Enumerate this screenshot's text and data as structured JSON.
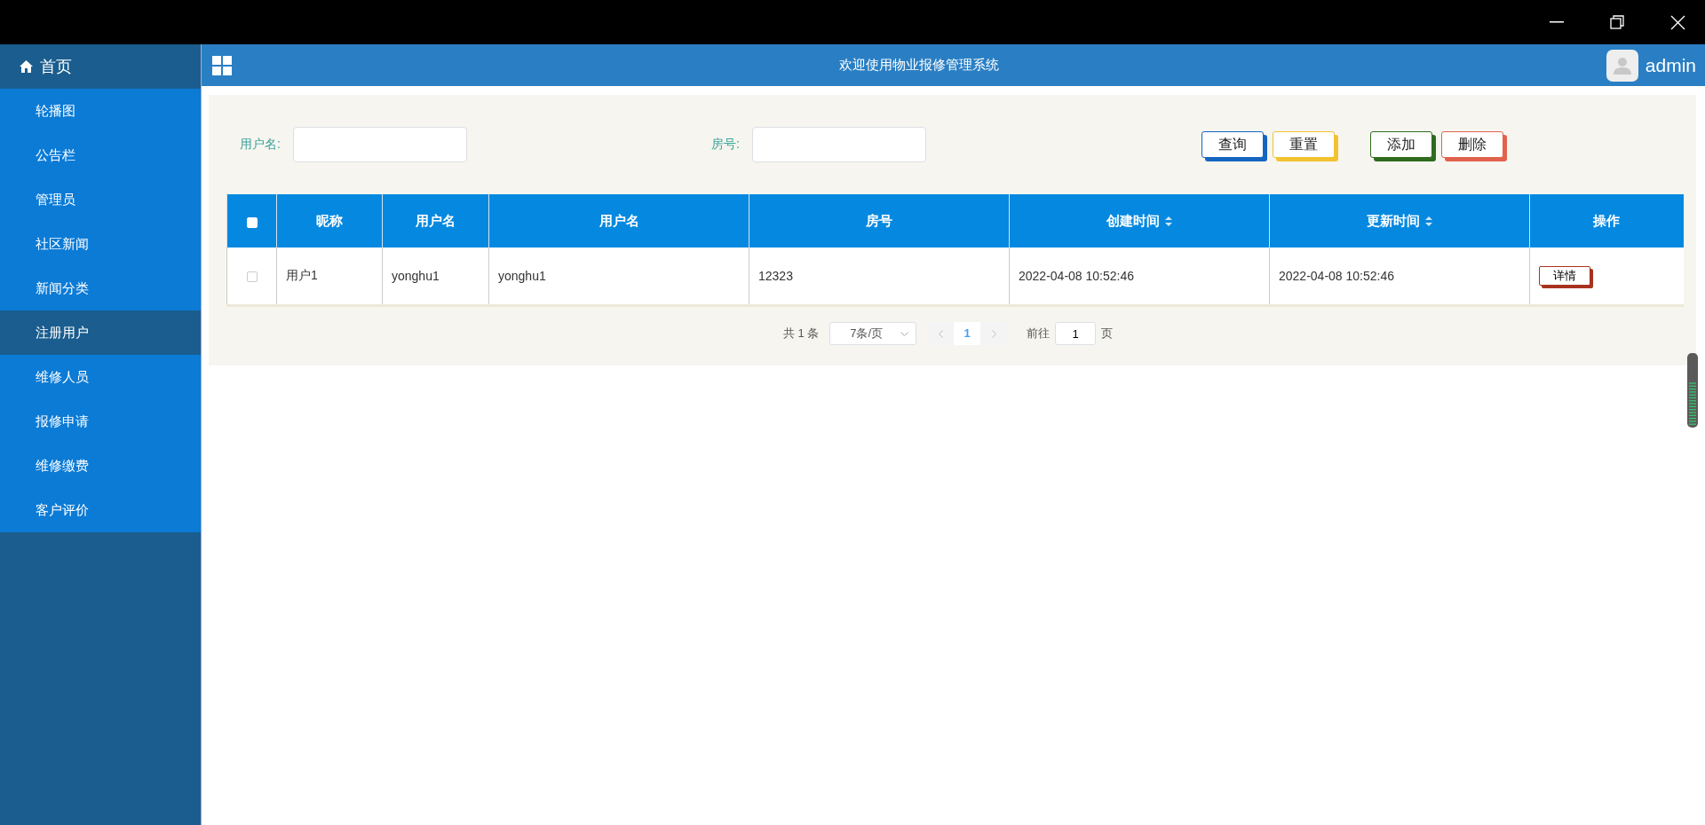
{
  "sidebar": {
    "home": {
      "label": "首页"
    },
    "items": [
      {
        "label": "轮播图",
        "selected": false
      },
      {
        "label": "公告栏",
        "selected": false
      },
      {
        "label": "管理员",
        "selected": false
      },
      {
        "label": "社区新闻",
        "selected": false
      },
      {
        "label": "新闻分类",
        "selected": false
      },
      {
        "label": "注册用户",
        "selected": true
      },
      {
        "label": "维修人员",
        "selected": false
      },
      {
        "label": "报修申请",
        "selected": false
      },
      {
        "label": "维修缴费",
        "selected": false
      },
      {
        "label": "客户评价",
        "selected": false
      }
    ]
  },
  "header": {
    "title": "欢迎使用物业报修管理系统",
    "user": "admin"
  },
  "search": {
    "fields": [
      {
        "label": "用户名:"
      },
      {
        "label": "房号:"
      }
    ],
    "button_groups": [
      {
        "buttons": [
          {
            "label": "查询",
            "color": "#1565c0"
          },
          {
            "label": "重置",
            "color": "#f2c230"
          }
        ]
      },
      {
        "buttons": [
          {
            "label": "添加",
            "color": "#2e6b1e"
          },
          {
            "label": "删除",
            "color": "#e2614d"
          }
        ]
      }
    ]
  },
  "table": {
    "select_all": {
      "checked": false
    },
    "columns": [
      {
        "label": "昵称",
        "sortable": false
      },
      {
        "label": "用户名",
        "sortable": false
      },
      {
        "label": "用户名",
        "sortable": false
      },
      {
        "label": "房号",
        "sortable": false
      },
      {
        "label": "创建时间",
        "sortable": true
      },
      {
        "label": "更新时间",
        "sortable": true
      },
      {
        "label": "操作",
        "sortable": false
      }
    ],
    "rows": [
      {
        "checked": false,
        "cells": [
          "用户1",
          "yonghu1",
          "yonghu1",
          "12323",
          "2022-04-08 10:52:46",
          "2022-04-08 10:52:46"
        ],
        "action": "详情"
      }
    ]
  },
  "pagination": {
    "total": "共 1 条",
    "page_size": "7条/页",
    "pages": [
      {
        "label": "1",
        "selected": true
      }
    ],
    "goto_label": "前往",
    "goto_value": "1",
    "goto_suffix": "页"
  }
}
